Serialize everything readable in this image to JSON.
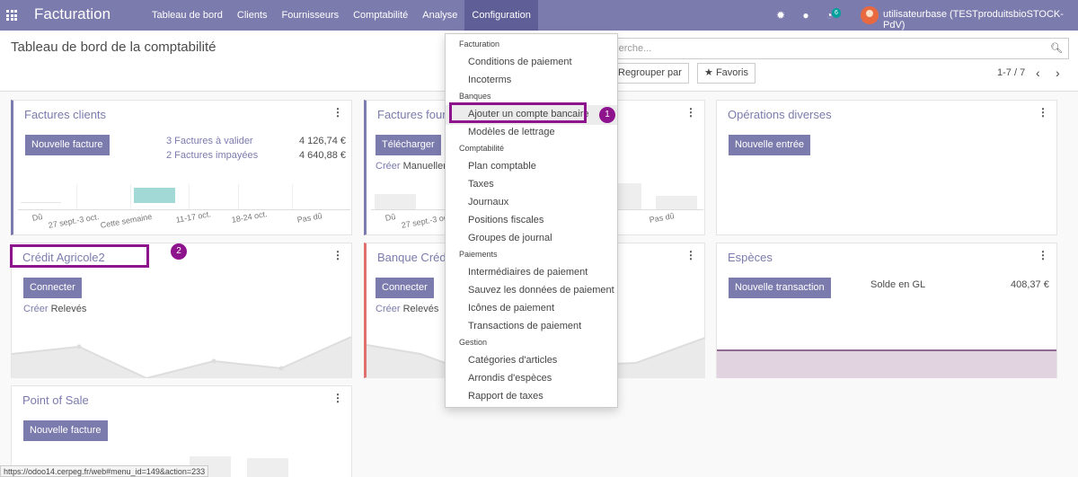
{
  "navbar": {
    "brand": "Facturation",
    "menu": [
      "Tableau de bord",
      "Clients",
      "Fournisseurs",
      "Comptabilité",
      "Analyse",
      "Configuration"
    ],
    "badge": "6",
    "user": "utilisateurbase (TESTproduitsbioSTOCK-PdV)"
  },
  "control_panel": {
    "title": "Tableau de bord de la comptabilité",
    "search_placeholder": "cherche...",
    "group_by": "Regrouper par",
    "favorites": "Favoris",
    "pager": "1-7 / 7"
  },
  "cards": {
    "factures_clients": {
      "title": "Factures clients",
      "button": "Nouvelle facture",
      "link1": "3 Factures à valider",
      "amount1": "4 126,74 €",
      "link2": "2 Factures impayées",
      "amount2": "4 640,88 €",
      "axis": [
        "Dû",
        "27 sept.-3 oct.",
        "Cette semaine",
        "11-17 oct.",
        "18-24 oct.",
        "Pas dû"
      ]
    },
    "factures_fournisseurs": {
      "title": "Factures fourn",
      "button": "Télécharger",
      "create": "Créer",
      "create_rest": "Manuellem",
      "axis": [
        "Dû",
        "27 sept.-3 oc",
        "Pas dû"
      ]
    },
    "operations_diverses": {
      "title": "Opérations diverses",
      "button": "Nouvelle entrée"
    },
    "credit_agricole": {
      "title": "Crédit Agricole2",
      "button": "Connecter",
      "create": "Créer",
      "releves": "Relevés"
    },
    "banque_credit": {
      "title": "Banque Crédi",
      "button": "Connecter",
      "create": "Créer",
      "releves": "Relevés"
    },
    "especes": {
      "title": "Espèces",
      "button": "Nouvelle transaction",
      "balance_label": "Solde en GL",
      "balance": "408,37 €"
    },
    "point_of_sale": {
      "title": "Point of Sale",
      "button": "Nouvelle facture"
    }
  },
  "dropdown": {
    "sections": [
      {
        "header": "Facturation",
        "items": [
          "Conditions de paiement",
          "Incoterms"
        ]
      },
      {
        "header": "Banques",
        "items": [
          "Ajouter un compte bancaire",
          "Modèles de lettrage"
        ]
      },
      {
        "header": "Comptabilité",
        "items": [
          "Plan comptable",
          "Taxes",
          "Journaux",
          "Positions fiscales",
          "Groupes de journal"
        ]
      },
      {
        "header": "Paiements",
        "items": [
          "Intermédiaires de paiement",
          "Sauvez les données de paiement",
          "Icônes de paiement",
          "Transactions de paiement"
        ]
      },
      {
        "header": "Gestion",
        "items": [
          "Catégories d'articles",
          "Arrondis d'espèces",
          "Rapport de taxes"
        ]
      }
    ]
  },
  "annotations": {
    "marker1": "1",
    "marker2": "2"
  },
  "status_url": "https://odoo14.cerpeg.fr/web#menu_id=149&action=233",
  "colors": {
    "primary": "#7c7bad",
    "annotation": "#8e148e",
    "teal_bar": "#a2d8d6"
  }
}
